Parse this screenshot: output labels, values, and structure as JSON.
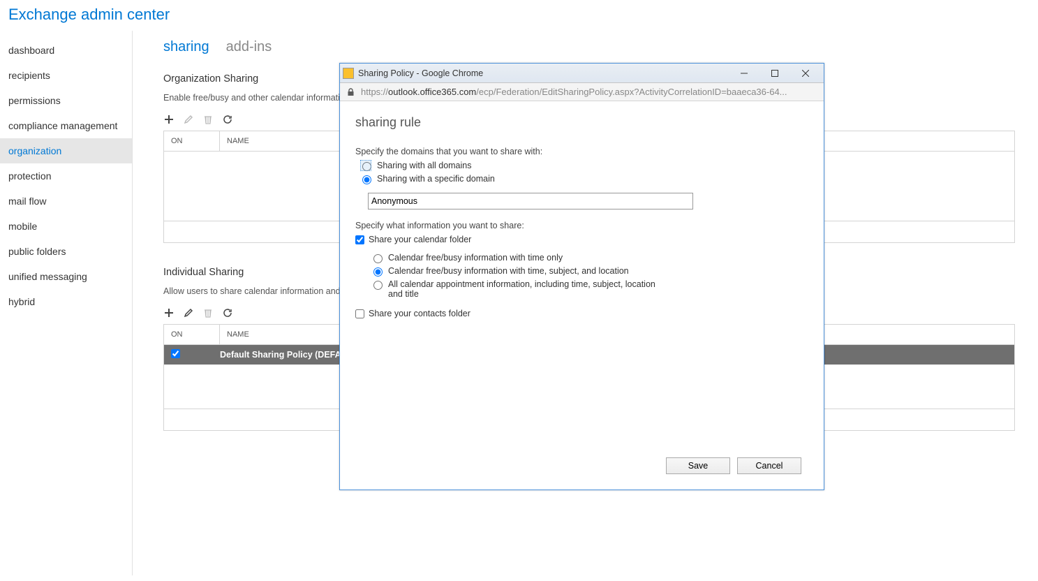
{
  "header": {
    "title": "Exchange admin center"
  },
  "sidebar": {
    "items": [
      "dashboard",
      "recipients",
      "permissions",
      "compliance management",
      "organization",
      "protection",
      "mail flow",
      "mobile",
      "public folders",
      "unified messaging",
      "hybrid"
    ],
    "active_index": 4
  },
  "tabs": {
    "items": [
      "sharing",
      "add-ins"
    ],
    "active_index": 0
  },
  "org_sharing": {
    "title": "Organization Sharing",
    "desc": "Enable free/busy and other calendar information",
    "columns": {
      "on": "ON",
      "name": "NAME"
    }
  },
  "ind_sharing": {
    "title": "Individual Sharing",
    "desc": "Allow users to share calendar information and c",
    "columns": {
      "on": "ON",
      "name": "NAME"
    },
    "rows": [
      {
        "on_checked": true,
        "name": "Default Sharing Policy (DEFAULT)"
      }
    ]
  },
  "popup": {
    "window_title": "Sharing Policy - Google Chrome",
    "url_prefix": "https://",
    "url_dark": "outlook.office365.com",
    "url_suffix": "/ecp/Federation/EditSharingPolicy.aspx?ActivityCorrelationID=baaeca36-64...",
    "title": "sharing rule",
    "domains_label": "Specify the domains that you want to share with:",
    "share_all_label": "Sharing with all domains",
    "share_specific_label": "Sharing with a specific domain",
    "domain_value": "Anonymous",
    "info_label": "Specify what information you want to share:",
    "share_calendar_label": "Share your calendar folder",
    "share_calendar_checked": true,
    "cal_opt1": "Calendar free/busy information with time only",
    "cal_opt2": "Calendar free/busy information with time, subject, and location",
    "cal_opt3": "All calendar appointment information, including time, subject, location and title",
    "cal_selected": 2,
    "share_contacts_label": "Share your contacts folder",
    "share_contacts_checked": false,
    "save": "Save",
    "cancel": "Cancel"
  }
}
